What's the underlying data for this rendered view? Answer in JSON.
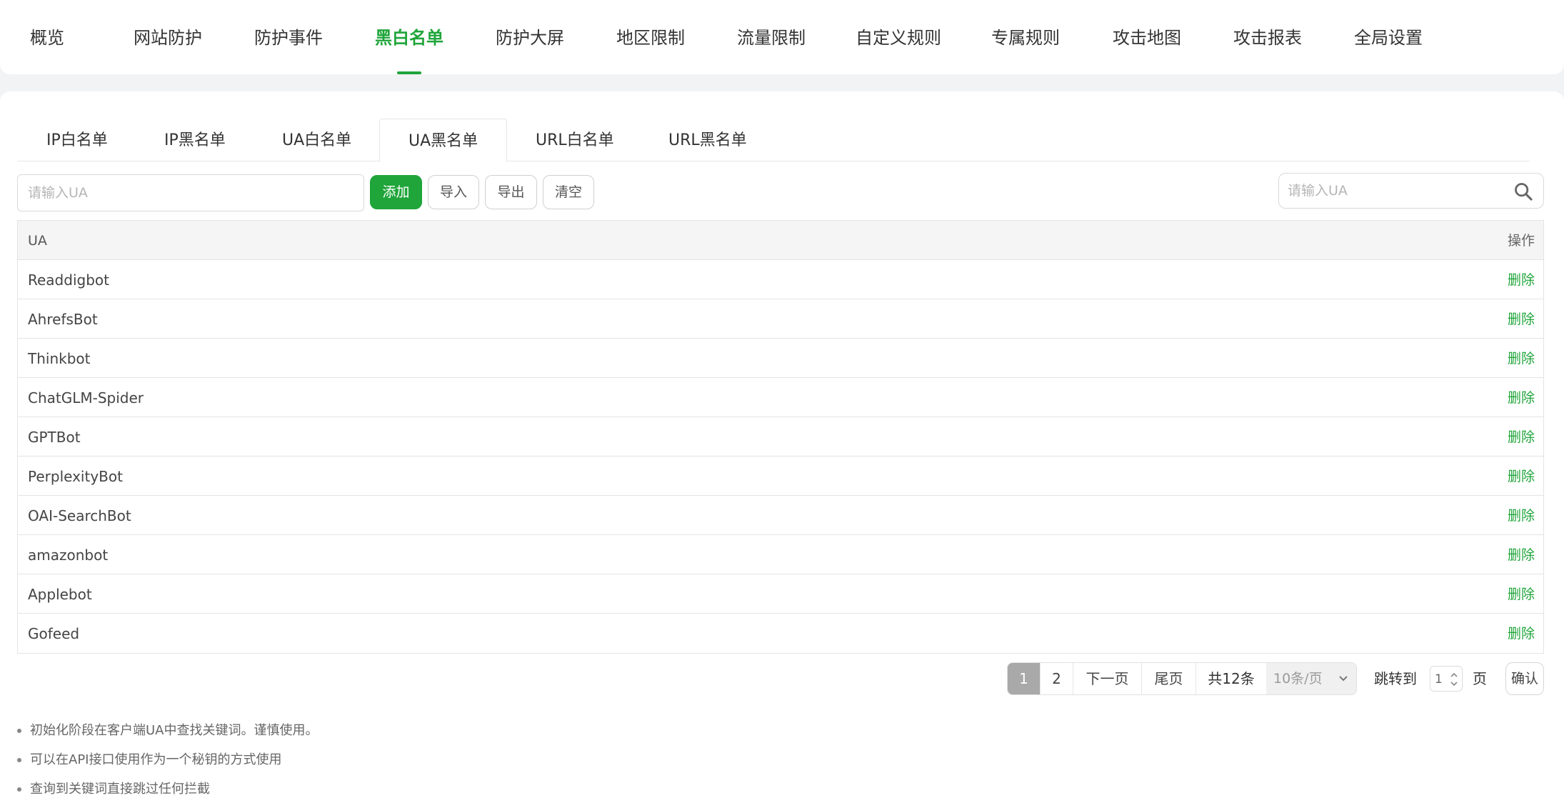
{
  "topnav": {
    "items": [
      {
        "label": "概览",
        "active": false
      },
      {
        "label": "网站防护",
        "active": false
      },
      {
        "label": "防护事件",
        "active": false
      },
      {
        "label": "黑白名单",
        "active": true
      },
      {
        "label": "防护大屏",
        "active": false
      },
      {
        "label": "地区限制",
        "active": false
      },
      {
        "label": "流量限制",
        "active": false
      },
      {
        "label": "自定义规则",
        "active": false
      },
      {
        "label": "专属规则",
        "active": false
      },
      {
        "label": "攻击地图",
        "active": false
      },
      {
        "label": "攻击报表",
        "active": false
      },
      {
        "label": "全局设置",
        "active": false
      }
    ]
  },
  "subtabs": {
    "items": [
      {
        "label": "IP白名单",
        "active": false
      },
      {
        "label": "IP黑名单",
        "active": false
      },
      {
        "label": "UA白名单",
        "active": false
      },
      {
        "label": "UA黑名单",
        "active": true
      },
      {
        "label": "URL白名单",
        "active": false
      },
      {
        "label": "URL黑名单",
        "active": false
      }
    ]
  },
  "toolbar": {
    "ua_input_placeholder": "请输入UA",
    "add_label": "添加",
    "import_label": "导入",
    "export_label": "导出",
    "clear_label": "清空",
    "search_placeholder": "请输入UA"
  },
  "table": {
    "headers": {
      "ua": "UA",
      "action": "操作"
    },
    "rows": [
      {
        "ua": "Readdigbot",
        "action": "删除"
      },
      {
        "ua": "AhrefsBot",
        "action": "删除"
      },
      {
        "ua": "Thinkbot",
        "action": "删除"
      },
      {
        "ua": "ChatGLM-Spider",
        "action": "删除"
      },
      {
        "ua": "GPTBot",
        "action": "删除"
      },
      {
        "ua": "PerplexityBot",
        "action": "删除"
      },
      {
        "ua": "OAI-SearchBot",
        "action": "删除"
      },
      {
        "ua": "amazonbot",
        "action": "删除"
      },
      {
        "ua": "Applebot",
        "action": "删除"
      },
      {
        "ua": "Gofeed",
        "action": "删除"
      }
    ]
  },
  "pagination": {
    "pages": [
      "1",
      "2"
    ],
    "current_page": "1",
    "next_label": "下一页",
    "last_label": "尾页",
    "total_label": "共12条",
    "page_size": "10条/页",
    "jump_label": "跳转到",
    "jump_value": "1",
    "page_suffix": "页",
    "confirm_label": "确认"
  },
  "notes": [
    "初始化阶段在客户端UA中查找关键词。谨慎使用。",
    "可以在API接口使用作为一个秘钥的方式使用",
    "查询到关键词直接跳过任何拦截"
  ],
  "colors": {
    "accent": "#20a53a",
    "page_bg": "#f2f3f5",
    "current_page_bg": "#a9a9a9"
  }
}
